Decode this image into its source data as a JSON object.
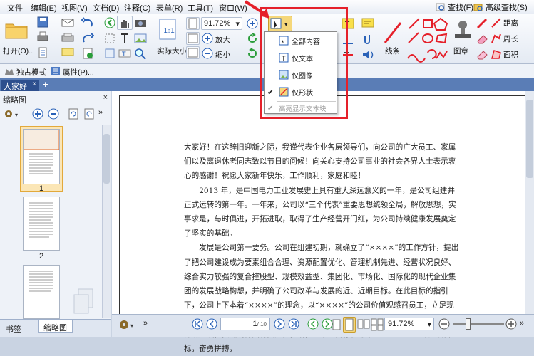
{
  "menubar": {
    "items": [
      "文件",
      "编辑(E)",
      "视图(V)",
      "文档(D)",
      "注释(C)",
      "表单(R)",
      "工具(T)",
      "窗口(W)"
    ],
    "find_label": "查找(F)",
    "advanced_find_label": "高级查找(S)"
  },
  "ribbon": {
    "open_label": "打开(O)...",
    "zoom_value": "91.72%",
    "actual_size_label": "实际大小",
    "zoom_in_label": "放大",
    "zoom_out_label": "缩小",
    "line_label": "线条",
    "stamp_label": "图章",
    "distance_label": "距离",
    "perimeter_label": "周长",
    "area_label": "面积",
    "exclusive_mode_label": "独占模式",
    "properties_label": "属性(P)..."
  },
  "select_dropdown": {
    "items": [
      {
        "label": "全部内容",
        "checked": false,
        "enabled": true
      },
      {
        "label": "仅文本",
        "checked": false,
        "enabled": true
      },
      {
        "label": "仅图像",
        "checked": false,
        "enabled": true
      },
      {
        "label": "仅形状",
        "checked": true,
        "enabled": true
      },
      {
        "label": "高亮显示文本块",
        "checked": true,
        "enabled": false
      }
    ]
  },
  "tabs": {
    "document_tab": "大家好",
    "new_tab_symbol": "+"
  },
  "sidebar": {
    "title": "缩略图",
    "thumbnails": [
      {
        "page": "1"
      },
      {
        "page": "2"
      }
    ],
    "bottom_tabs": [
      "书签",
      "缩略图"
    ]
  },
  "document": {
    "paragraphs": [
      "大家好！在这辞旧迎新之际，我谨代表企业各层领导们，向公司的广大员工、家属们以及离退休老同志致以节日的问候！向关心支持公司事业的社会各界人士表示衷心的感谢！祝愿大家新年快乐，工作顺利，家庭和睦！",
      "2013 年，是中国电力工业发展史上具有重大深远意义的一年，是公司组建并正式运转的第一年。一年来，公司以“三个代表”重要思想统领全局，解放思想，实事求是，与时俱进，开拓进取，取得了生产经营开门红，为公司持续健康发展奠定了坚实的基础。",
      "发展是公司第一要务。公司在组建初期，就确立了“××××”的工作方针，提出了把公司建设成为要素组合合理、资源配置优化、管理机制先进、经营状况良好、综合实力较强的复合控股型、规模效益型、集团化、市场化、国际化的现代企业集团的发展战略构想，并明确了公司改革与发展的近、近期目标。在此目标的指引下，公司上下本着“××××”的理念，以“××××”的公司价值观感召员工，立足现有、抢抓机遇，以安全生产为基础，对内“强化管理，提高效益”，对外积极开拓电源点建设，按照确保国有资产保值增值的效益目标和每年“××××”的电源建设目标，奋勇拼搏，"
    ]
  },
  "statusbar": {
    "page_indicator": "1",
    "page_total": "/ 10",
    "zoom_value": "91.72%"
  }
}
